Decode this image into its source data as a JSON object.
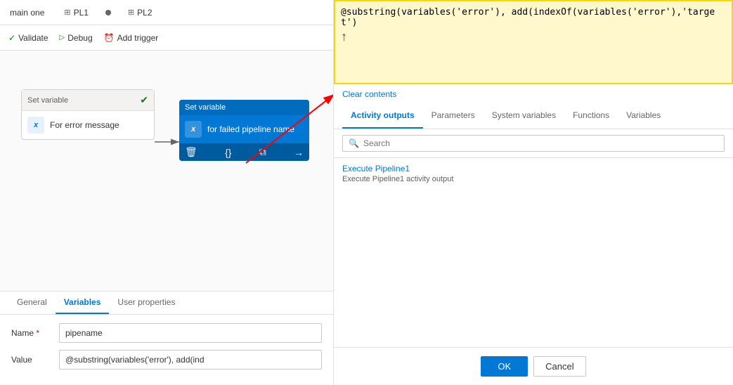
{
  "tabs": {
    "main_one": "main one",
    "pl1_icon": "⊞",
    "pl1": "PL1",
    "pl2_icon": "⊞",
    "pl2": "PL2"
  },
  "toolbar": {
    "validate": "Validate",
    "debug": "Debug",
    "add_trigger": "Add trigger"
  },
  "nodes": {
    "node1": {
      "header": "Set variable",
      "label": "For error message"
    },
    "node2": {
      "header": "Set variable",
      "label": "for failed pipeline name"
    }
  },
  "bottom_tabs": {
    "general": "General",
    "variables": "Variables",
    "user_properties": "User properties"
  },
  "form": {
    "name_label": "Name",
    "name_required": "*",
    "name_value": "pipename",
    "value_label": "Value",
    "value_placeholder": "@substring(variables('error'), add(ind"
  },
  "right_panel": {
    "expression": "@substring(variables('error'),  add(indexOf(variables('error'),'target')",
    "clear_contents": "Clear contents",
    "tabs": {
      "activity_outputs": "Activity outputs",
      "parameters": "Parameters",
      "system_variables": "System variables",
      "functions": "Functions",
      "variables": "Variables"
    },
    "search_placeholder": "Search",
    "activity_item_title": "Execute Pipeline1",
    "activity_item_subtitle": "Execute Pipeline1 activity output"
  },
  "footer": {
    "ok": "OK",
    "cancel": "Cancel"
  }
}
